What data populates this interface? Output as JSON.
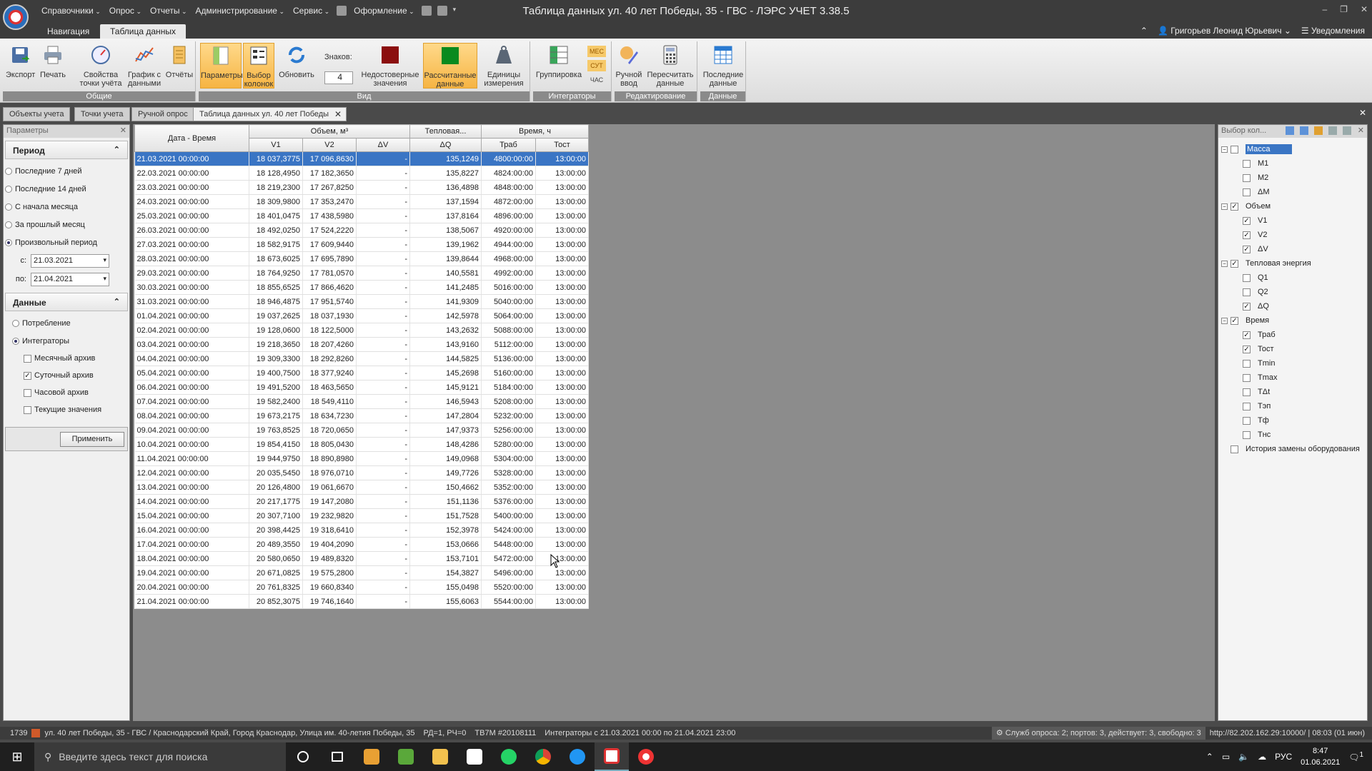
{
  "window": {
    "title": "Таблица данных ул. 40 лет Победы, 35 - ГВС - ЛЭРС УЧЕТ 3.38.5",
    "menu": [
      "Справочники",
      "Опрос",
      "Отчеты",
      "Администрирование",
      "Сервис",
      "Оформление"
    ]
  },
  "ribbon_tabs": [
    "Навигация",
    "Таблица данных"
  ],
  "user": {
    "name": "Григорьев Леонид Юрьевич",
    "notifications": "Уведомления"
  },
  "ribbon": {
    "export": "Экспорт",
    "print": "Печать",
    "point_props": [
      "Свойства",
      "точки учёта"
    ],
    "graph": [
      "График с",
      "данными"
    ],
    "reports": "Отчёты",
    "group_general": "Общие",
    "params": "Параметры",
    "column_choice": [
      "Выбор",
      "колонок"
    ],
    "refresh": "Обновить",
    "digits_label": "Знаков:",
    "digits_value": "4",
    "unreliable": [
      "Недостоверные",
      "значения"
    ],
    "calculated": [
      "Рассчитанные",
      "данные"
    ],
    "units": [
      "Единицы",
      "измерения"
    ],
    "group_view": "Вид",
    "grouping": "Группировка",
    "tag_mes": "МЕС",
    "tag_sut": "СУТ",
    "tag_chas": "ЧАС",
    "group_integrators": "Интеграторы",
    "manual_input": [
      "Ручной",
      "ввод"
    ],
    "recalc": [
      "Пересчитать",
      "данные"
    ],
    "group_edit": "Редактирование",
    "last_data": [
      "Последние",
      "данные"
    ],
    "group_data": "Данные"
  },
  "doc_tabs": [
    "Объекты учета",
    "Точки учета",
    "Ручной опрос",
    "Таблица данных ул. 40 лет Победы"
  ],
  "left_panel": {
    "header": "Параметры",
    "period_title": "Период",
    "period_options": [
      "Последние 7 дней",
      "Последние 14 дней",
      "С начала месяца",
      "За прошлый месяц",
      "Произвольный период"
    ],
    "from_label": "с:",
    "from_value": "21.03.2021",
    "to_label": "по:",
    "to_value": "21.04.2021",
    "data_title": "Данные",
    "data_options": [
      "Потребление",
      "Интеграторы"
    ],
    "archives": [
      {
        "label": "Месячный архив",
        "checked": false
      },
      {
        "label": "Суточный архив",
        "checked": true
      },
      {
        "label": "Часовой архив",
        "checked": false
      },
      {
        "label": "Текущие значения",
        "checked": false
      }
    ],
    "apply": "Применить"
  },
  "grid": {
    "group_headers": [
      "Дата - Время",
      "Объем, м³",
      "Тепловая...",
      "Время, ч"
    ],
    "columns": [
      "V1",
      "V2",
      "ΔV",
      "ΔQ",
      "Траб",
      "Тост"
    ],
    "rows": [
      [
        "21.03.2021 00:00:00",
        "18 037,3775",
        "17 096,8630",
        "-",
        "135,1249",
        "4800:00:00",
        "13:00:00"
      ],
      [
        "22.03.2021 00:00:00",
        "18 128,4950",
        "17 182,3650",
        "-",
        "135,8227",
        "4824:00:00",
        "13:00:00"
      ],
      [
        "23.03.2021 00:00:00",
        "18 219,2300",
        "17 267,8250",
        "-",
        "136,4898",
        "4848:00:00",
        "13:00:00"
      ],
      [
        "24.03.2021 00:00:00",
        "18 309,9800",
        "17 353,2470",
        "-",
        "137,1594",
        "4872:00:00",
        "13:00:00"
      ],
      [
        "25.03.2021 00:00:00",
        "18 401,0475",
        "17 438,5980",
        "-",
        "137,8164",
        "4896:00:00",
        "13:00:00"
      ],
      [
        "26.03.2021 00:00:00",
        "18 492,0250",
        "17 524,2220",
        "-",
        "138,5067",
        "4920:00:00",
        "13:00:00"
      ],
      [
        "27.03.2021 00:00:00",
        "18 582,9175",
        "17 609,9440",
        "-",
        "139,1962",
        "4944:00:00",
        "13:00:00"
      ],
      [
        "28.03.2021 00:00:00",
        "18 673,6025",
        "17 695,7890",
        "-",
        "139,8644",
        "4968:00:00",
        "13:00:00"
      ],
      [
        "29.03.2021 00:00:00",
        "18 764,9250",
        "17 781,0570",
        "-",
        "140,5581",
        "4992:00:00",
        "13:00:00"
      ],
      [
        "30.03.2021 00:00:00",
        "18 855,6525",
        "17 866,4620",
        "-",
        "141,2485",
        "5016:00:00",
        "13:00:00"
      ],
      [
        "31.03.2021 00:00:00",
        "18 946,4875",
        "17 951,5740",
        "-",
        "141,9309",
        "5040:00:00",
        "13:00:00"
      ],
      [
        "01.04.2021 00:00:00",
        "19 037,2625",
        "18 037,1930",
        "-",
        "142,5978",
        "5064:00:00",
        "13:00:00"
      ],
      [
        "02.04.2021 00:00:00",
        "19 128,0600",
        "18 122,5000",
        "-",
        "143,2632",
        "5088:00:00",
        "13:00:00"
      ],
      [
        "03.04.2021 00:00:00",
        "19 218,3650",
        "18 207,4260",
        "-",
        "143,9160",
        "5112:00:00",
        "13:00:00"
      ],
      [
        "04.04.2021 00:00:00",
        "19 309,3300",
        "18 292,8260",
        "-",
        "144,5825",
        "5136:00:00",
        "13:00:00"
      ],
      [
        "05.04.2021 00:00:00",
        "19 400,7500",
        "18 377,9240",
        "-",
        "145,2698",
        "5160:00:00",
        "13:00:00"
      ],
      [
        "06.04.2021 00:00:00",
        "19 491,5200",
        "18 463,5650",
        "-",
        "145,9121",
        "5184:00:00",
        "13:00:00"
      ],
      [
        "07.04.2021 00:00:00",
        "19 582,2400",
        "18 549,4110",
        "-",
        "146,5943",
        "5208:00:00",
        "13:00:00"
      ],
      [
        "08.04.2021 00:00:00",
        "19 673,2175",
        "18 634,7230",
        "-",
        "147,2804",
        "5232:00:00",
        "13:00:00"
      ],
      [
        "09.04.2021 00:00:00",
        "19 763,8525",
        "18 720,0650",
        "-",
        "147,9373",
        "5256:00:00",
        "13:00:00"
      ],
      [
        "10.04.2021 00:00:00",
        "19 854,4150",
        "18 805,0430",
        "-",
        "148,4286",
        "5280:00:00",
        "13:00:00"
      ],
      [
        "11.04.2021 00:00:00",
        "19 944,9750",
        "18 890,8980",
        "-",
        "149,0968",
        "5304:00:00",
        "13:00:00"
      ],
      [
        "12.04.2021 00:00:00",
        "20 035,5450",
        "18 976,0710",
        "-",
        "149,7726",
        "5328:00:00",
        "13:00:00"
      ],
      [
        "13.04.2021 00:00:00",
        "20 126,4800",
        "19 061,6670",
        "-",
        "150,4662",
        "5352:00:00",
        "13:00:00"
      ],
      [
        "14.04.2021 00:00:00",
        "20 217,1775",
        "19 147,2080",
        "-",
        "151,1136",
        "5376:00:00",
        "13:00:00"
      ],
      [
        "15.04.2021 00:00:00",
        "20 307,7100",
        "19 232,9820",
        "-",
        "151,7528",
        "5400:00:00",
        "13:00:00"
      ],
      [
        "16.04.2021 00:00:00",
        "20 398,4425",
        "19 318,6410",
        "-",
        "152,3978",
        "5424:00:00",
        "13:00:00"
      ],
      [
        "17.04.2021 00:00:00",
        "20 489,3550",
        "19 404,2090",
        "-",
        "153,0666",
        "5448:00:00",
        "13:00:00"
      ],
      [
        "18.04.2021 00:00:00",
        "20 580,0650",
        "19 489,8320",
        "-",
        "153,7101",
        "5472:00:00",
        "13:00:00"
      ],
      [
        "19.04.2021 00:00:00",
        "20 671,0825",
        "19 575,2800",
        "-",
        "154,3827",
        "5496:00:00",
        "13:00:00"
      ],
      [
        "20.04.2021 00:00:00",
        "20 761,8325",
        "19 660,8340",
        "-",
        "155,0498",
        "5520:00:00",
        "13:00:00"
      ],
      [
        "21.04.2021 00:00:00",
        "20 852,3075",
        "19 746,1640",
        "-",
        "155,6063",
        "5544:00:00",
        "13:00:00"
      ]
    ]
  },
  "right_panel": {
    "header": "Выбор кол...",
    "tree": [
      {
        "label": "Масса",
        "level": 0,
        "checked": false,
        "expandable": true,
        "selected": true
      },
      {
        "label": "M1",
        "level": 1,
        "checked": false
      },
      {
        "label": "M2",
        "level": 1,
        "checked": false
      },
      {
        "label": "ΔM",
        "level": 1,
        "checked": false
      },
      {
        "label": "Объем",
        "level": 0,
        "checked": true,
        "expandable": true
      },
      {
        "label": "V1",
        "level": 1,
        "checked": true
      },
      {
        "label": "V2",
        "level": 1,
        "checked": true
      },
      {
        "label": "ΔV",
        "level": 1,
        "checked": true
      },
      {
        "label": "Тепловая энергия",
        "level": 0,
        "checked": true,
        "expandable": true
      },
      {
        "label": "Q1",
        "level": 1,
        "checked": false
      },
      {
        "label": "Q2",
        "level": 1,
        "checked": false
      },
      {
        "label": "ΔQ",
        "level": 1,
        "checked": true
      },
      {
        "label": "Время",
        "level": 0,
        "checked": true,
        "expandable": true
      },
      {
        "label": "Траб",
        "level": 1,
        "checked": true
      },
      {
        "label": "Тост",
        "level": 1,
        "checked": true
      },
      {
        "label": "Tmin",
        "level": 1,
        "checked": false
      },
      {
        "label": "Tmax",
        "level": 1,
        "checked": false
      },
      {
        "label": "TΔt",
        "level": 1,
        "checked": false
      },
      {
        "label": "Tэп",
        "level": 1,
        "checked": false
      },
      {
        "label": "Tф",
        "level": 1,
        "checked": false
      },
      {
        "label": "Tнс",
        "level": 1,
        "checked": false
      },
      {
        "label": "История замены оборудования",
        "level": 0,
        "checked": false
      }
    ]
  },
  "status": {
    "id": "1739",
    "object": "ул. 40 лет Победы, 35 - ГВС / Краснодарский Край, Город Краснодар, Улица им. 40-летия Победы, 35",
    "rd": "РД=1, РЧ=0",
    "device": "ТВ7М #20108111",
    "range": "Интеграторы с 21.03.2021 00:00 по 21.04.2021 23:00",
    "services": "Служб опроса: 2; портов: 3, действует: 3, свободно: 3",
    "server": "http://82.202.162.29:10000/ | 08:03 (01 июн)"
  },
  "taskbar": {
    "search_placeholder": "Введите здесь текст для поиска",
    "lang": "РУС",
    "time": "8:47",
    "date": "01.06.2021",
    "notif_count": "1"
  },
  "colors": {
    "selection": "#3a75c4",
    "ribbon_active": "#f6b443",
    "chrome_dark": "#3c3c3c"
  }
}
